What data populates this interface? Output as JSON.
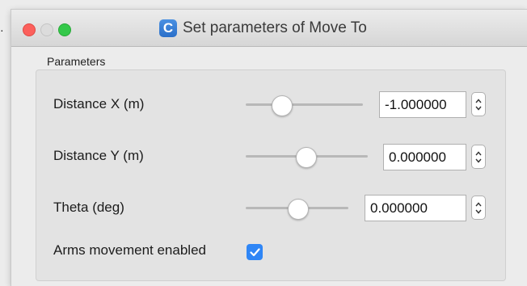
{
  "window": {
    "title": "Set parameters of Move To",
    "app_icon_letter": "C"
  },
  "groupbox": {
    "label": "Parameters"
  },
  "rows": [
    {
      "label": "Distance X (m)",
      "value": "-1.000000",
      "slider_fraction": 0.33
    },
    {
      "label": "Distance Y (m)",
      "value": "0.000000",
      "slider_fraction": 0.5
    },
    {
      "label": "Theta (deg)",
      "value": "0.000000",
      "slider_fraction": 0.5
    }
  ],
  "arms": {
    "label": "Arms movement enabled",
    "checked": true
  },
  "colors": {
    "accent": "#2f86f6",
    "close": "#fc605c",
    "maximize": "#34c84a"
  },
  "icons": [
    "app-c-icon",
    "stepper-up-icon",
    "stepper-down-icon",
    "checkmark-icon"
  ]
}
